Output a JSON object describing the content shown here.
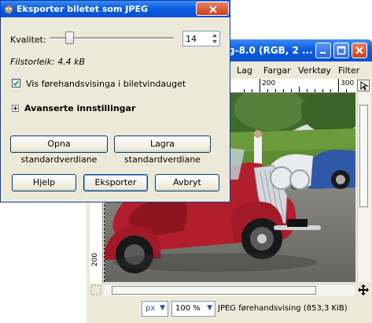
{
  "image_window": {
    "title": "-8.0 (RGB, 2 ...",
    "title_prefix_hidden": "g",
    "menus": [
      {
        "label": "Lag",
        "mnemonic": "L"
      },
      {
        "label": "Fargar",
        "mnemonic": "F"
      },
      {
        "label": "Verktøy",
        "mnemonic": "V"
      },
      {
        "label": "Filter",
        "mnemonic": "F"
      }
    ],
    "ruler_top_labels": [
      "200",
      "300"
    ],
    "ruler_left_label": "200",
    "statusbar": {
      "unit": "px",
      "zoom": "100 %",
      "status": "JPEG førehandsvising (853,3 KiB)"
    }
  },
  "dialog": {
    "title": "Eksporter biletet som JPEG",
    "quality_label": "Kvalitet:",
    "quality_value": "14",
    "quality_fraction": 0.14,
    "filesize": "Filstorleik: 4.4 kB",
    "preview_checked": true,
    "preview_label": "Vis førehandsvisinga i biletvindauget",
    "advanced_label": "Avanserte innstillingar",
    "load_defaults": "Opna standardverdiane",
    "save_defaults": "Lagra standardverdiane",
    "help": "Hjelp",
    "export": "Eksporter",
    "cancel": "Avbryt"
  },
  "colors": {
    "titlebar": "#0a5ee0",
    "dialog_bg": "#ece9d8",
    "close_btn": "#c8401c",
    "car_red": "#b21e2c"
  }
}
